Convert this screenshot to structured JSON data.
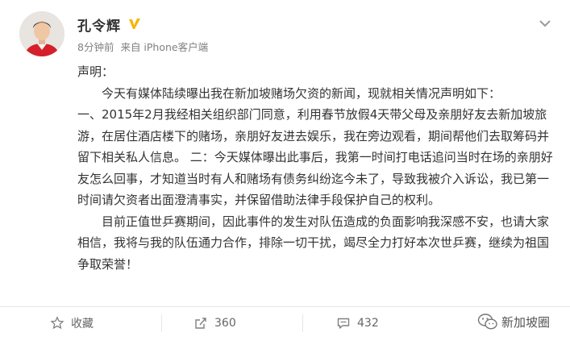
{
  "post": {
    "author": "孔令辉",
    "time": "8分钟前",
    "source": "来自 iPhone客户端",
    "greeting": "声明：",
    "paragraphs": [
      "今天有媒体陆续曝出我在新加坡赌场欠资的新闻，现就相关情况声明如下：",
      "一、2015年2月我经相关组织部门同意，利用春节放假4天带父母及亲朋好友去新加坡旅游，在居住酒店楼下的赌场，亲朋好友进去娱乐，我在旁边观看，期间帮他们去取筹码并留下相关私人信息。  二：今天媒体曝出此事后，我第一时间打电话追问当时在场的亲朋好友怎么回事，才知道当时有人和赌场有债务纠纷迄今未了，导致我被介入诉讼，我已第一时间请欠资者出面澄清事实，并保留借助法律手段保护自己的权利。",
      "目前正值世乒赛期间，因此事件的发生对队伍造成的负面影响我深感不安，也请大家相信，我将与我的队伍通力合作，排除一切干扰，竭尽全力打好本次世乒赛，继续为祖国争取荣誉！"
    ]
  },
  "actions": {
    "favorite": "收藏",
    "repost_count": "360",
    "comment_count": "432"
  },
  "watermark": "新加坡圈",
  "icons": {
    "verified": "verified-v-badge-icon",
    "more": "chevron-down-icon",
    "favorite": "star-icon",
    "repost": "share-square-icon",
    "comment": "comment-bubble-icon",
    "watermark_logo": "wechat-icon"
  },
  "colors": {
    "verified": "#f7b500",
    "text": "#333333",
    "meta": "#808080"
  }
}
